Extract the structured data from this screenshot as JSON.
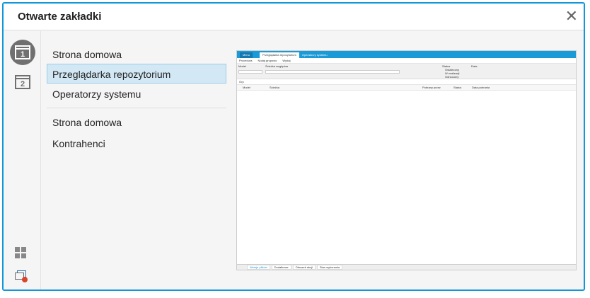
{
  "dialog": {
    "title": "Otwarte zakładki",
    "close": "✕"
  },
  "rail": {
    "tabs": [
      {
        "number": "1",
        "active": true
      },
      {
        "number": "2",
        "active": false
      }
    ]
  },
  "tabs": {
    "group1": [
      "Strona domowa",
      "Przeglądarka repozytorium",
      "Operatorzy systemu"
    ],
    "group2": [
      "Strona domowa",
      "Kontrahenci"
    ],
    "selected": "Przeglądarka repozytorium"
  },
  "preview": {
    "titlebar": {
      "menu": "Menu",
      "tabs": [
        "Przeglądarka repozytorium",
        "Operatorzy systemu"
      ]
    },
    "toolbar": [
      "Procedura",
      "Nodaj grupowo",
      "Wydaj"
    ],
    "filters": {
      "model": "Model",
      "sciezka": "Ścieżka względna",
      "status": "Status",
      "data": "Data",
      "statuses": [
        "Ostateczny",
        "W realizacji",
        "Odrzucony"
      ]
    },
    "columns": [
      "Model",
      "Ścieżka",
      "Pobrany przez",
      "Status",
      "Data pobrania"
    ],
    "group_label": "Grp",
    "bottom_tabs": [
      "Wersje plików",
      "Dodatkowe",
      "Obrazek akcji",
      "Stan wykonania"
    ]
  }
}
